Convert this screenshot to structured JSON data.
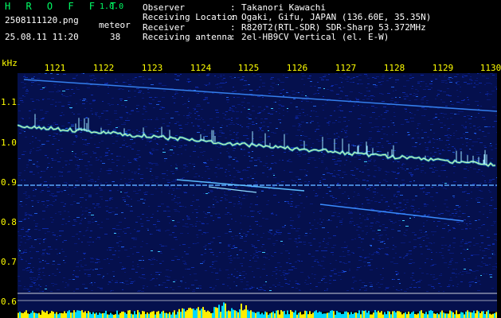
{
  "colors": {
    "background": "#000000",
    "header_green": "#00ff66",
    "text_white": "#ffffff",
    "axis_yellow": "#ffff00",
    "waterfall_noise": "#0a1f8a",
    "signal_line": "#4aa0ff",
    "echo_trace": "#b8ffb0",
    "bottom_bars_cyan": "#00d8ff",
    "bottom_bars_yellow": "#ffee00"
  },
  "header": {
    "app_title": "H R O F F T",
    "app_version": "1.0.0",
    "file_name": "2508111120.png",
    "meteor_label": "meteor",
    "datetime": "25.08.11 11:20",
    "meteor_count": "38"
  },
  "info": [
    {
      "label": "Observer",
      "sep": ":",
      "value": "Takanori Kawachi"
    },
    {
      "label": "Receiving Location",
      "sep": ":",
      "value": "Ogaki, Gifu, JAPAN (136.60E, 35.35N)"
    },
    {
      "label": "Receiver",
      "sep": ":",
      "value": "R820T2(RTL-SDR) SDR-Sharp 53.372MHz"
    },
    {
      "label": "Receiving antenna",
      "sep": ":",
      "value": "2el-HB9CV Vertical (el. E-W)"
    }
  ],
  "freq_axis": {
    "unit": "kHz",
    "labels": [
      "1.1",
      "1.0",
      "0.9",
      "0.8",
      "0.7",
      "0.6"
    ]
  },
  "time_axis": {
    "labels": [
      "1121",
      "1122",
      "1123",
      "1124",
      "1125",
      "1126",
      "1127",
      "1128",
      "1129",
      "1130"
    ]
  }
}
